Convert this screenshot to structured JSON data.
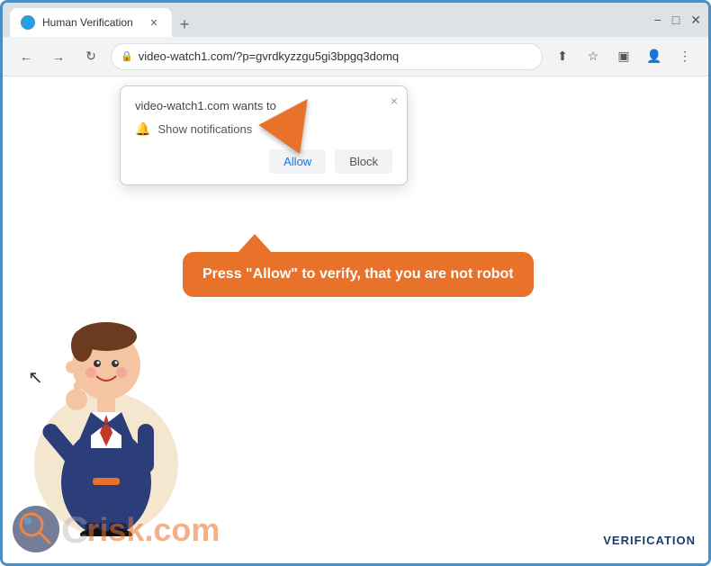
{
  "browser": {
    "tab": {
      "title": "Human Verification",
      "favicon": "🌐"
    },
    "new_tab_label": "+",
    "window_controls": {
      "minimize": "−",
      "maximize": "□",
      "close": "✕"
    },
    "nav": {
      "back": "←",
      "forward": "→",
      "refresh": "↻",
      "url": "video-watch1.com/?p=gvrdkyzzgu5gi3bpgq3domq",
      "share_icon": "⬆",
      "bookmark_icon": "☆",
      "sidebar_icon": "▣",
      "profile_icon": "👤",
      "menu_icon": "⋮"
    }
  },
  "popup": {
    "title": "video-watch1.com wants to",
    "close": "×",
    "notification_text": "Show notifications",
    "allow_label": "Allow",
    "block_label": "Block"
  },
  "speech_bubble": {
    "text": "Press \"Allow\" to verify, that you are not robot"
  },
  "watermark": {
    "text": "C",
    "risk_text": "risk.com"
  },
  "verification": {
    "label": "VERIFICATION"
  }
}
